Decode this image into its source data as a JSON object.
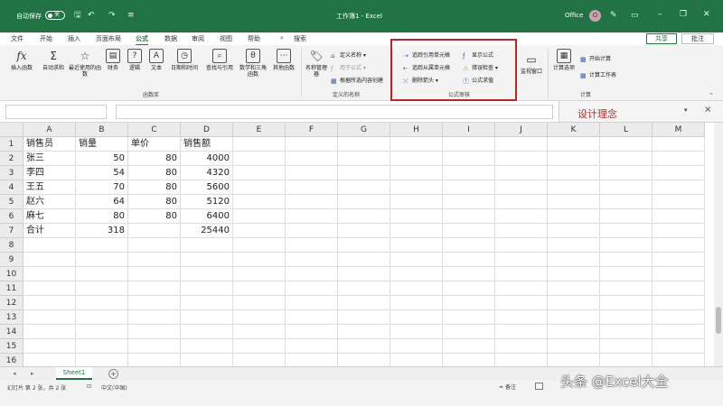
{
  "titlebar": {
    "autosave_label": "自动保存",
    "autosave_state": "关",
    "title": "工作簿1 - Excel",
    "office": "Office",
    "avatar": "O"
  },
  "menu": {
    "tabs": [
      "文件",
      "开始",
      "插入",
      "页面布局",
      "公式",
      "数据",
      "审阅",
      "视图",
      "帮助",
      "搜索"
    ],
    "active": "公式",
    "share": "共享",
    "comment": "批注"
  },
  "ribbon": {
    "function_library": {
      "group_label": "函数库",
      "buttons": [
        "插入函数",
        "自动求和",
        "最近使用的函数",
        "财务",
        "逻辑",
        "文本",
        "日期和时间",
        "查找与引用",
        "数学和三角函数",
        "其他函数"
      ]
    },
    "defined_names": {
      "group_label": "定义的名称",
      "name_manager": "名称管理器",
      "define_name": "定义名称",
      "use_in_formula": "用于公式",
      "create_from_selection": "根据所选内容创建"
    },
    "formula_auditing": {
      "group_label": "公式审核",
      "trace_precedents": "追踪引用单元格",
      "trace_dependents": "追踪从属单元格",
      "remove_arrows": "删除箭头",
      "show_formulas": "显示公式",
      "error_checking": "错误检查",
      "evaluate_formula": "公式求值",
      "watch_window": "监视窗口"
    },
    "calculation": {
      "group_label": "计算",
      "calc_options": "计算选项",
      "calc_now": "开始计算",
      "calc_sheet": "计算工作表"
    }
  },
  "taskpane": {
    "title": "设计理念"
  },
  "sheet": {
    "columns": [
      "A",
      "B",
      "C",
      "D",
      "E",
      "F",
      "G",
      "H",
      "I",
      "J",
      "K",
      "L",
      "M"
    ],
    "rows": [
      [
        "销售员",
        "销量",
        "单价",
        "销售额"
      ],
      [
        "张三",
        "50",
        "80",
        "4000"
      ],
      [
        "李四",
        "54",
        "80",
        "4320"
      ],
      [
        "王五",
        "70",
        "80",
        "5600"
      ],
      [
        "赵六",
        "64",
        "80",
        "5120"
      ],
      [
        "麻七",
        "80",
        "80",
        "6400"
      ],
      [
        "合计",
        "318",
        "",
        "25440"
      ],
      [],
      [],
      [],
      [],
      [],
      [],
      [],
      [],
      [],
      []
    ]
  },
  "tabs": {
    "sheet1": "Sheet1"
  },
  "status": {
    "left": "幻灯片 第 2 张，共 2 张",
    "lang": "中文(中国)",
    "display": "备注"
  },
  "watermark": "头条 @Excel大全"
}
